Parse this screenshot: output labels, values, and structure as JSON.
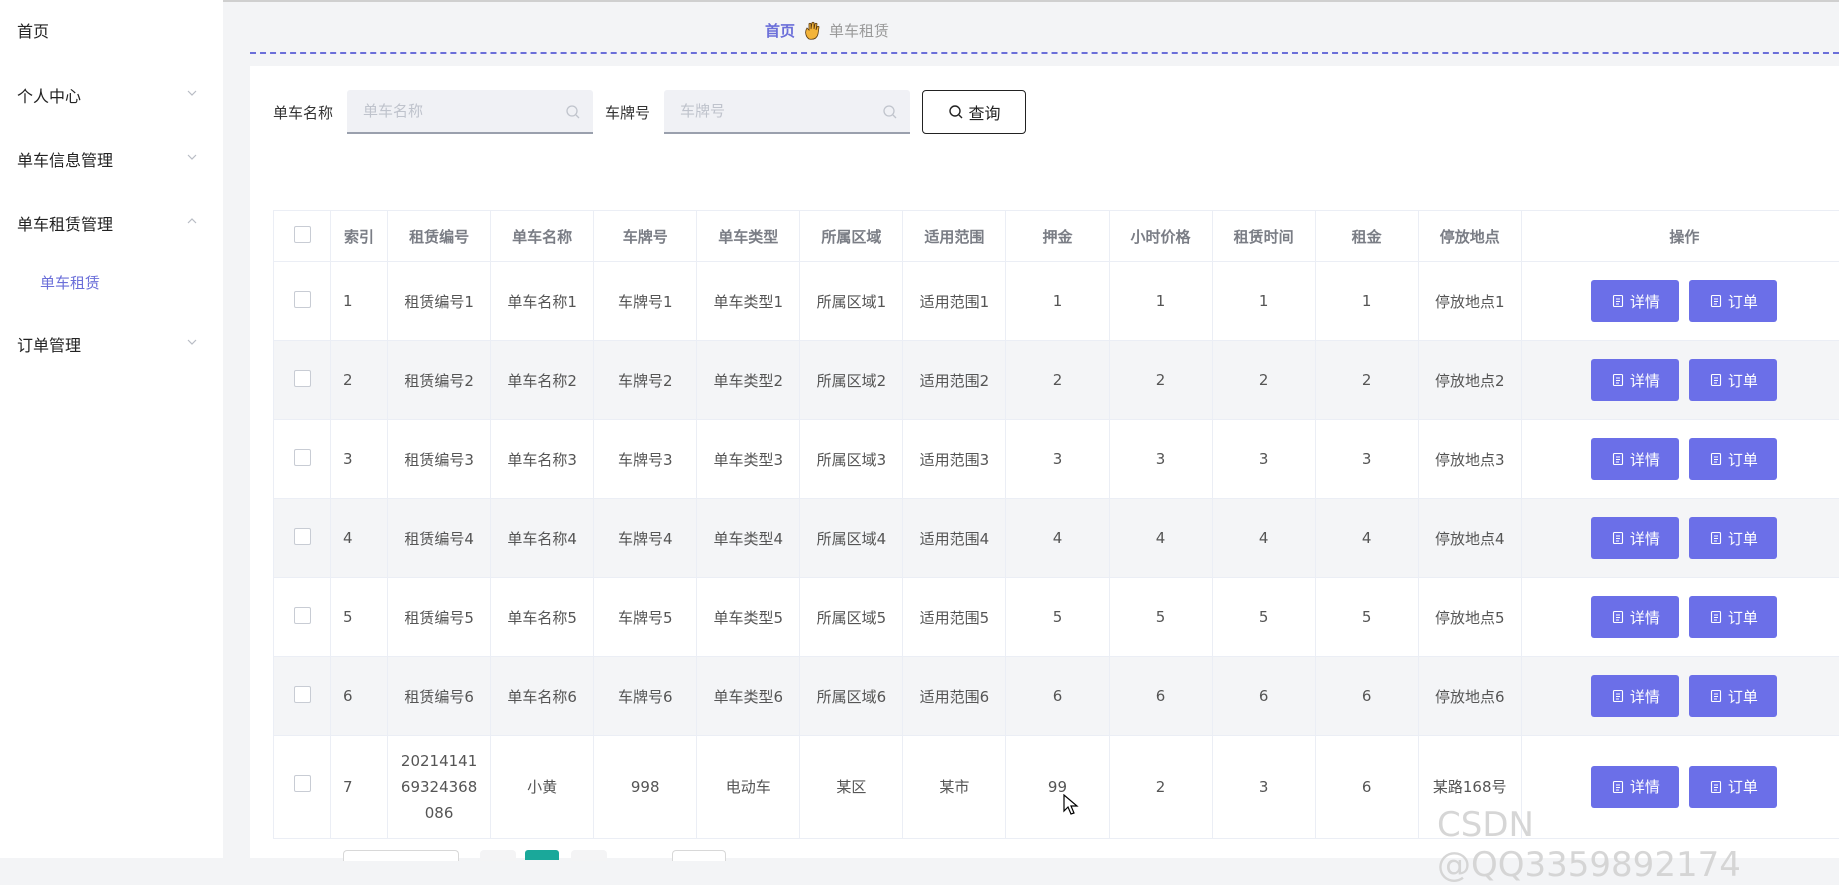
{
  "sidebar": {
    "items": [
      {
        "label": "首页",
        "expanded": null
      },
      {
        "label": "个人中心",
        "expanded": false
      },
      {
        "label": "单车信息管理",
        "expanded": false
      },
      {
        "label": "单车租赁管理",
        "expanded": true,
        "children": [
          {
            "label": "单车租赁"
          }
        ]
      },
      {
        "label": "订单管理",
        "expanded": false
      }
    ]
  },
  "breadcrumb": {
    "home": "首页",
    "current": "单车租赁"
  },
  "search": {
    "name_label": "单车名称",
    "name_placeholder": "单车名称",
    "plate_label": "车牌号",
    "plate_placeholder": "车牌号",
    "query_label": "查询"
  },
  "table": {
    "headers": [
      "",
      "索引",
      "租赁编号",
      "单车名称",
      "车牌号",
      "单车类型",
      "所属区域",
      "适用范围",
      "押金",
      "小时价格",
      "租赁时间",
      "租金",
      "停放地点",
      "操作"
    ],
    "rows": [
      [
        "1",
        "租赁编号1",
        "单车名称1",
        "车牌号1",
        "单车类型1",
        "所属区域1",
        "适用范围1",
        "1",
        "1",
        "1",
        "1",
        "停放地点1"
      ],
      [
        "2",
        "租赁编号2",
        "单车名称2",
        "车牌号2",
        "单车类型2",
        "所属区域2",
        "适用范围2",
        "2",
        "2",
        "2",
        "2",
        "停放地点2"
      ],
      [
        "3",
        "租赁编号3",
        "单车名称3",
        "车牌号3",
        "单车类型3",
        "所属区域3",
        "适用范围3",
        "3",
        "3",
        "3",
        "3",
        "停放地点3"
      ],
      [
        "4",
        "租赁编号4",
        "单车名称4",
        "车牌号4",
        "单车类型4",
        "所属区域4",
        "适用范围4",
        "4",
        "4",
        "4",
        "4",
        "停放地点4"
      ],
      [
        "5",
        "租赁编号5",
        "单车名称5",
        "车牌号5",
        "单车类型5",
        "所属区域5",
        "适用范围5",
        "5",
        "5",
        "5",
        "5",
        "停放地点5"
      ],
      [
        "6",
        "租赁编号6",
        "单车名称6",
        "车牌号6",
        "单车类型6",
        "所属区域6",
        "适用范围6",
        "6",
        "6",
        "6",
        "6",
        "停放地点6"
      ],
      [
        "7",
        "2021414169324368086",
        "小黄",
        "998",
        "电动车",
        "某区",
        "某市",
        "99",
        "2",
        "3",
        "6",
        "某路168号"
      ]
    ],
    "detail_label": "详情",
    "order_label": "订单"
  },
  "watermark": "CSDN @QQ3359892174",
  "colors": {
    "accent": "#6b6fe8",
    "link": "#6b6fd9",
    "pager_active": "#1aa89a"
  }
}
